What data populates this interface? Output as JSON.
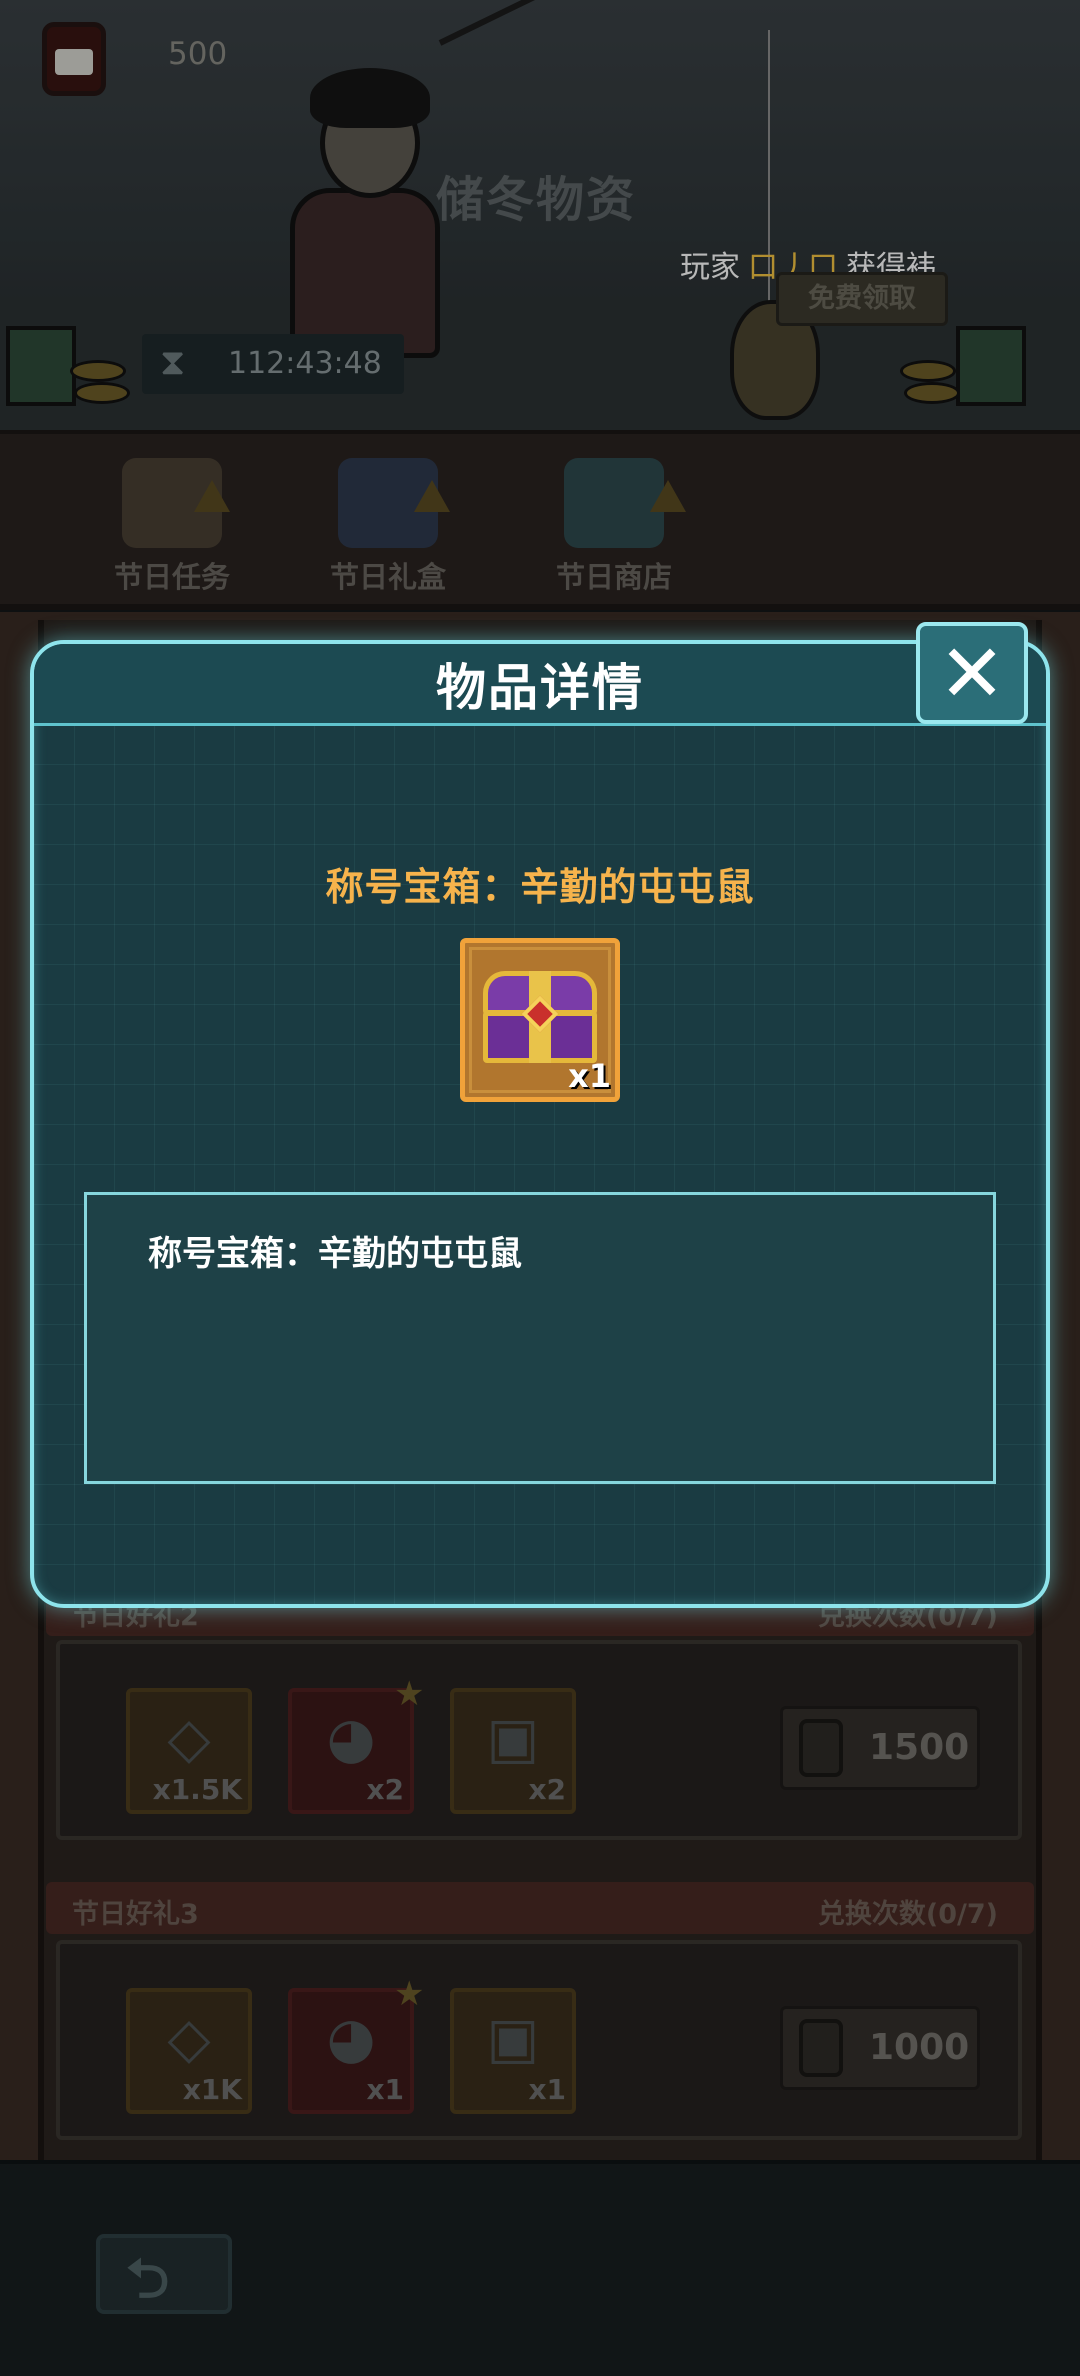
{
  "hud": {
    "resource_amount": "500",
    "resource_icon": "jam-jar-icon"
  },
  "event": {
    "title": "储冬物资",
    "ticker_prefix": "玩家",
    "ticker_player": "口丿口",
    "ticker_suffix": "获得袆",
    "free_claim_label": "免费领取",
    "timer": "112:43:48"
  },
  "tabs": [
    {
      "label": "节日任务",
      "icon": "scroll-icon"
    },
    {
      "label": "节日礼盒",
      "icon": "gift-box-icon"
    },
    {
      "label": "节日商店",
      "icon": "shop-gift-icon"
    }
  ],
  "gifts": [
    {
      "name": "节日好礼2",
      "limit": "兑换次数(0/7)",
      "items": [
        {
          "icon": "diamond-icon",
          "qty": "x1.5K"
        },
        {
          "icon": "duck-soldier-icon",
          "qty": "x2"
        },
        {
          "icon": "chest-icon",
          "qty": "x2"
        }
      ],
      "price": "1500"
    },
    {
      "name": "节日好礼3",
      "limit": "兑换次数(0/7)",
      "items": [
        {
          "icon": "diamond-icon",
          "qty": "x1K"
        },
        {
          "icon": "duck-soldier-icon",
          "qty": "x1"
        },
        {
          "icon": "chest-icon",
          "qty": "x1"
        }
      ],
      "price": "1000"
    }
  ],
  "modal": {
    "title": "物品详情",
    "close_symbol": "✕",
    "item_name": "称号宝箱：辛勤的屯屯鼠",
    "item_qty": "x1",
    "description": "称号宝箱：辛勤的屯屯鼠"
  },
  "colors": {
    "accent": "#8ee4ec",
    "item_name": "#f6b34c",
    "modal_bg": "#1a3b42"
  }
}
